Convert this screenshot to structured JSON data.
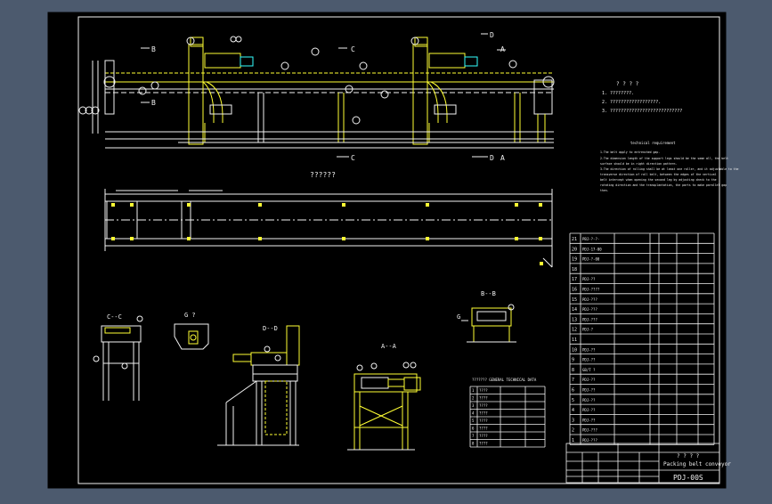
{
  "colors": {
    "viewport_bg": "#4c5a6e",
    "sheet_bg": "#000000",
    "yellow": "#ffff33",
    "white": "#f2f2f2",
    "cyan": "#33ffff",
    "magenta": "#ff33ff"
  },
  "section_marks": {
    "b_top": "B",
    "b_bottom": "B",
    "c_top": "C",
    "c_bottom": "C",
    "d_top": "D",
    "d_bottom": "D",
    "a_top": "A",
    "a_bottom": "A"
  },
  "views": {
    "plan_title": "??????",
    "section_cc": "C--C",
    "section_g": "G ?",
    "section_dd": "D--D",
    "section_aa": "A--A",
    "section_bb": "B--B",
    "section_g_small": "G"
  },
  "notes": {
    "tech_title": "? ? ? ?",
    "tech_lines": [
      "1. ????????.",
      "2. ??????????????????.",
      "3. ???????????????????????????"
    ],
    "req_title": "technical requirement",
    "req_lines": [
      "1.The belt apply to entrenched gap.",
      "2.The dimension length of the support legs should be the same all, the belt",
      "  surface should be in right direction pattern.",
      "3.The direction of rolling shall be at least one roller, and it adjustable to the",
      "  transverse direction of roll belt, between the edges of the vertical",
      "  belt intercept when opening the second leg by adjusting check to the",
      "  rotating direction and the transplantation, the parts to make parallel gap",
      "  then."
    ]
  },
  "bom_rows": [
    {
      "no": "21",
      "code": "PBJ-?-?-",
      "name": "",
      "qty": "",
      "material": "",
      "note": ""
    },
    {
      "no": "20",
      "code": "PDJ-17-00",
      "name": "",
      "qty": "",
      "material": "",
      "note": ""
    },
    {
      "no": "19",
      "code": "PDJ-?-00",
      "name": "",
      "qty": "",
      "material": "",
      "note": ""
    },
    {
      "no": "18",
      "code": "",
      "name": "",
      "qty": "",
      "material": "",
      "note": ""
    },
    {
      "no": "17",
      "code": "PDJ-??",
      "name": "",
      "qty": "",
      "material": "",
      "note": ""
    },
    {
      "no": "16",
      "code": "PDJ-????",
      "name": "",
      "qty": "",
      "material": "",
      "note": ""
    },
    {
      "no": "15",
      "code": "PDJ-???",
      "name": "",
      "qty": "",
      "material": "",
      "note": ""
    },
    {
      "no": "14",
      "code": "PDJ-???",
      "name": "",
      "qty": "",
      "material": "",
      "note": ""
    },
    {
      "no": "13",
      "code": "PDJ-???",
      "name": "",
      "qty": "",
      "material": "",
      "note": ""
    },
    {
      "no": "12",
      "code": "PDJ-?",
      "name": "",
      "qty": "",
      "material": "",
      "note": ""
    },
    {
      "no": "11",
      "code": "",
      "name": "",
      "qty": "",
      "material": "",
      "note": ""
    },
    {
      "no": "10",
      "code": "PDJ-??",
      "name": "",
      "qty": "",
      "material": "",
      "note": ""
    },
    {
      "no": "9",
      "code": "PDJ-??",
      "name": "",
      "qty": "",
      "material": "",
      "note": ""
    },
    {
      "no": "8",
      "code": "GB/T ?",
      "name": "",
      "qty": "",
      "material": "",
      "note": ""
    },
    {
      "no": "7",
      "code": "PDJ-??",
      "name": "",
      "qty": "",
      "material": "",
      "note": ""
    },
    {
      "no": "6",
      "code": "PDJ-??",
      "name": "",
      "qty": "",
      "material": "",
      "note": ""
    },
    {
      "no": "5",
      "code": "PDJ-??",
      "name": "",
      "qty": "",
      "material": "",
      "note": ""
    },
    {
      "no": "4",
      "code": "PDJ-??",
      "name": "",
      "qty": "",
      "material": "",
      "note": ""
    },
    {
      "no": "3",
      "code": "PDJ-??",
      "name": "",
      "qty": "",
      "material": "",
      "note": ""
    },
    {
      "no": "2",
      "code": "PDJ-???",
      "name": "",
      "qty": "",
      "material": "",
      "note": ""
    },
    {
      "no": "1",
      "code": "PDJ-???",
      "name": "",
      "qty": "",
      "material": "",
      "note": ""
    }
  ],
  "spec_table": {
    "title": "??????? GENERAL TECHNICAL DATA",
    "rows": [
      [
        "1",
        "????",
        "",
        ""
      ],
      [
        "2",
        "????",
        "",
        ""
      ],
      [
        "3",
        "????",
        "",
        ""
      ],
      [
        "4",
        "????",
        "",
        ""
      ],
      [
        "5",
        "????",
        "",
        ""
      ],
      [
        "6",
        "????",
        "",
        ""
      ],
      [
        "7",
        "????",
        "",
        ""
      ],
      [
        "8",
        "????",
        "",
        ""
      ]
    ]
  },
  "title_block": {
    "project_cn": "? ? ? ?",
    "project_en": "Packing belt conveyor",
    "drawing_no": "PDJ-00S"
  }
}
